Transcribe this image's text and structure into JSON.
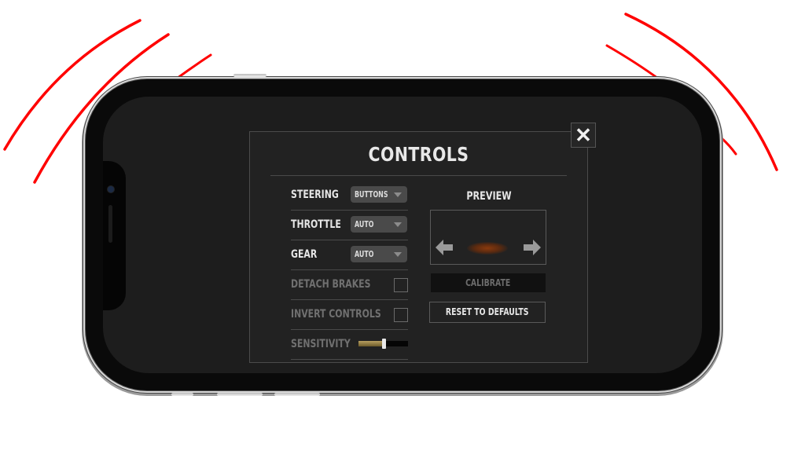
{
  "dialog": {
    "title": "CONTROLS",
    "close_icon": "close-icon",
    "settings": [
      {
        "label": "STEERING",
        "type": "select",
        "value": "BUTTONS",
        "enabled": true
      },
      {
        "label": "THROTTLE",
        "type": "select",
        "value": "AUTO",
        "enabled": true
      },
      {
        "label": "GEAR",
        "type": "select",
        "value": "AUTO",
        "enabled": true
      },
      {
        "label": "DETACH BRAKES",
        "type": "checkbox",
        "checked": false,
        "enabled": false
      },
      {
        "label": "INVERT CONTROLS",
        "type": "checkbox",
        "checked": false,
        "enabled": false
      },
      {
        "label": "SENSITIVITY",
        "type": "slider",
        "value": 0.5,
        "enabled": false
      }
    ],
    "preview": {
      "label": "PREVIEW",
      "left_icon": "arrow-left-icon",
      "right_icon": "arrow-right-icon",
      "indicator_color": "#8a3a0e"
    },
    "calibrate_label": "CALIBRATE",
    "reset_label": "RESET TO DEFAULTS"
  },
  "colors": {
    "accent_swoosh": "#ff0000",
    "slider_fill": "#a08a48"
  }
}
